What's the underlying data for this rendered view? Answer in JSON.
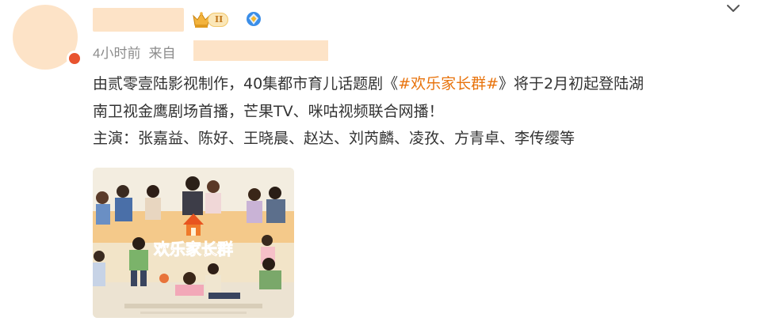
{
  "post": {
    "time": "4小时前",
    "source_prefix": "来自",
    "vip_level": "II",
    "content": {
      "line1_before": "由贰零壹陆影视制作，40集都市育儿话题剧《",
      "topic": "#欢乐家长群#",
      "line1_after": "》将于2月初起登陆湖",
      "line2": "南卫视金鹰剧场首播，芒果TV、咪咕视频联合网播！",
      "line3": "主演：张嘉益、陈好、王晓晨、赵达、刘芮麟、凌孜、方青卓、李传缨等"
    },
    "poster": {
      "title": "欢乐家长群"
    }
  },
  "colors": {
    "placeholder_fill": "#fde3c7",
    "topic_orange": "#e8730c",
    "meta_gray": "#8c8c8c",
    "text": "#333333"
  },
  "icons": {
    "vip": "crown-icon",
    "verify": "verified-badge-icon",
    "menu": "chevron-down-icon"
  }
}
